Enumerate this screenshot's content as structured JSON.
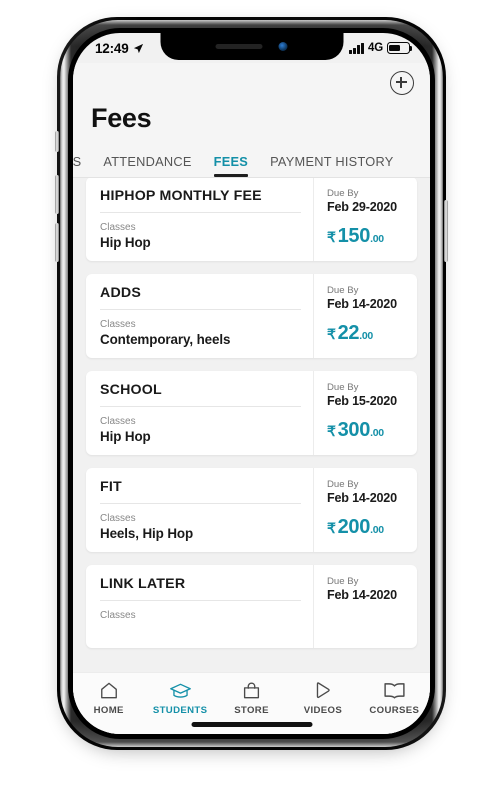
{
  "status_bar": {
    "time": "12:49",
    "location_icon": "location-arrow-icon",
    "network": "4G",
    "signal_icon": "signal-bars-icon",
    "battery_icon": "battery-icon"
  },
  "header": {
    "add_icon": "plus-circle-icon",
    "title": "Fees"
  },
  "tabs": [
    {
      "label": "SES",
      "active": false
    },
    {
      "label": "ATTENDANCE",
      "active": false
    },
    {
      "label": "FEES",
      "active": true
    },
    {
      "label": "PAYMENT HISTORY",
      "active": false
    }
  ],
  "fee_cards": [
    {
      "name": "HIPHOP MONTHLY FEE",
      "classes_label": "Classes",
      "classes": "Hip Hop",
      "due_label": "Due By",
      "due_date": "Feb 29-2020",
      "currency": "₹",
      "amount": "150",
      "decimals": ".00"
    },
    {
      "name": "ADDS",
      "classes_label": "Classes",
      "classes": "Contemporary, heels",
      "due_label": "Due By",
      "due_date": "Feb 14-2020",
      "currency": "₹",
      "amount": "22",
      "decimals": ".00"
    },
    {
      "name": "SCHOOL",
      "classes_label": "Classes",
      "classes": "Hip Hop",
      "due_label": "Due By",
      "due_date": "Feb 15-2020",
      "currency": "₹",
      "amount": "300",
      "decimals": ".00"
    },
    {
      "name": "FIT",
      "classes_label": "Classes",
      "classes": "Heels, Hip Hop",
      "due_label": "Due By",
      "due_date": "Feb 14-2020",
      "currency": "₹",
      "amount": "200",
      "decimals": ".00"
    },
    {
      "name": "LINK LATER",
      "classes_label": "Classes",
      "classes": "",
      "due_label": "Due By",
      "due_date": "Feb 14-2020",
      "currency": "₹",
      "amount": "",
      "decimals": ""
    }
  ],
  "bottom_nav": [
    {
      "label": "HOME",
      "icon": "home-icon",
      "active": false
    },
    {
      "label": "STUDENTS",
      "icon": "graduation-cap-icon",
      "active": true
    },
    {
      "label": "STORE",
      "icon": "shopping-bag-icon",
      "active": false
    },
    {
      "label": "VIDEOS",
      "icon": "play-icon",
      "active": false
    },
    {
      "label": "COURSES",
      "icon": "book-icon",
      "active": false
    }
  ],
  "colors": {
    "accent": "#1490a8",
    "text": "#1a1a1a",
    "muted": "#808080",
    "page_bg": "#f1f1f1",
    "card_bg": "#ffffff"
  }
}
